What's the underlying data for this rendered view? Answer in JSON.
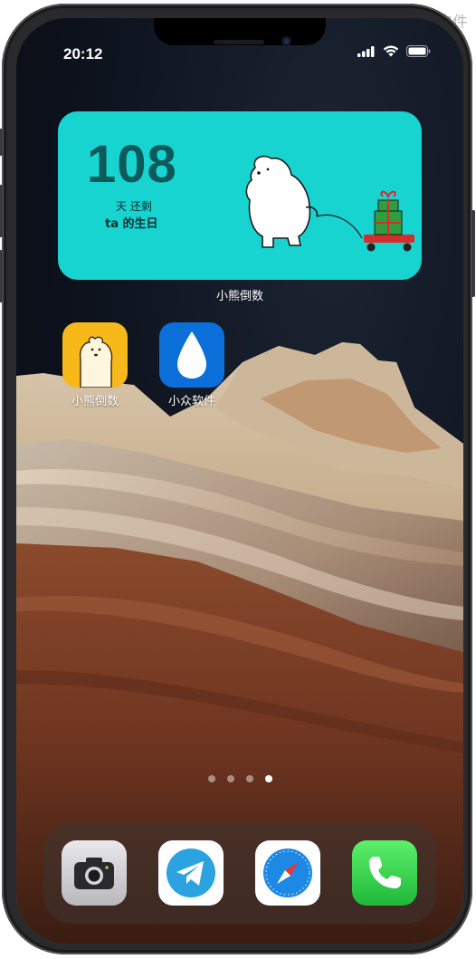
{
  "watermark": "小众软件",
  "status": {
    "time": "20:12"
  },
  "widget": {
    "count": "108",
    "unit": "天 还剩",
    "event": "ta 的生日",
    "app_name": "小熊倒数",
    "bg_color": "#17d4d0"
  },
  "apps": [
    {
      "label": "小熊倒数",
      "icon": "polar-bear-icon",
      "color": "#f7b81a"
    },
    {
      "label": "小众软件",
      "icon": "water-drop-icon",
      "color": "#0b6fd9"
    }
  ],
  "page_indicator": {
    "count": 4,
    "active": 4
  },
  "dock": [
    {
      "icon": "camera-icon"
    },
    {
      "icon": "telegram-icon"
    },
    {
      "icon": "safari-icon"
    },
    {
      "icon": "phone-icon"
    }
  ]
}
